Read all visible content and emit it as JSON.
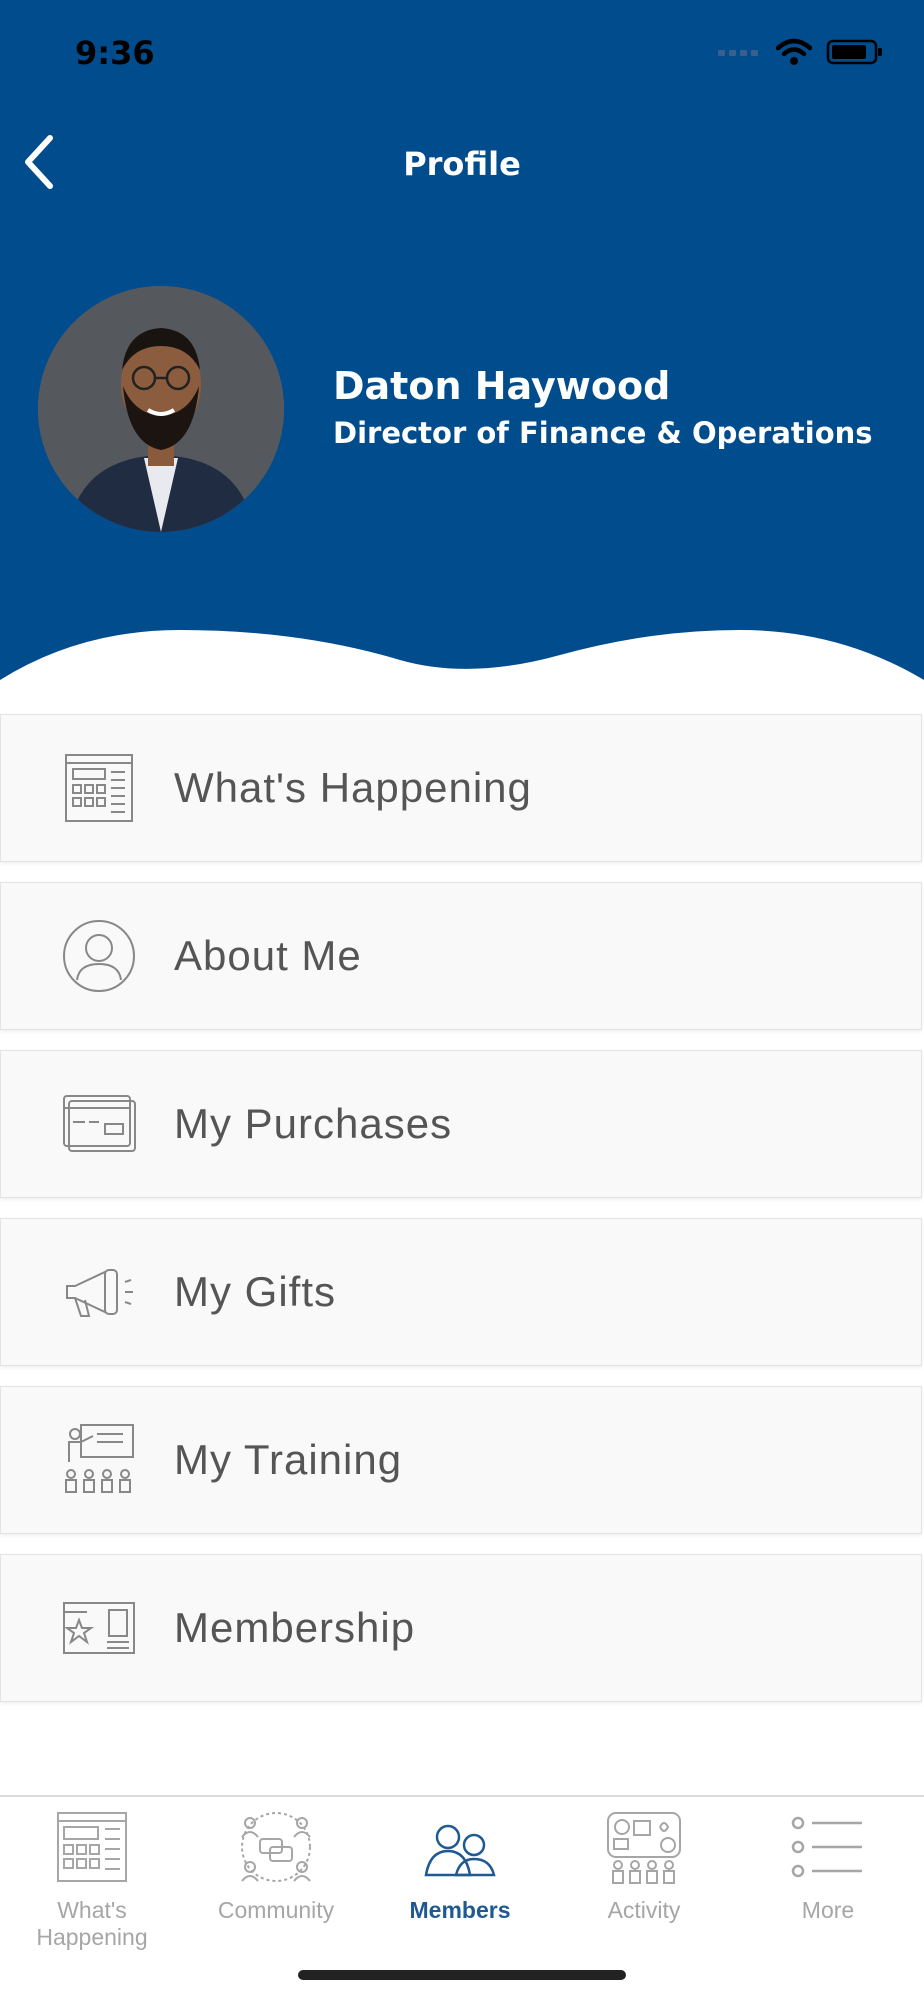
{
  "status_bar": {
    "time": "9:36"
  },
  "header": {
    "title": "Profile",
    "back_icon": "chevron-left-icon",
    "background_color": "#004c8c"
  },
  "profile": {
    "name": "Daton Haywood",
    "role": "Director of Finance & Operations"
  },
  "menu": {
    "items": [
      {
        "label": "What's Happening",
        "icon": "newspaper-icon"
      },
      {
        "label": "About Me",
        "icon": "user-circle-icon"
      },
      {
        "label": "My Purchases",
        "icon": "credit-card-icon"
      },
      {
        "label": "My Gifts",
        "icon": "megaphone-icon"
      },
      {
        "label": "My Training",
        "icon": "training-icon"
      },
      {
        "label": "Membership",
        "icon": "membership-card-icon"
      }
    ]
  },
  "tabbar": {
    "active": "Members",
    "active_color": "#1d5a94",
    "tabs": [
      {
        "label": "What's Happening",
        "icon": "newspaper-icon"
      },
      {
        "label": "Community",
        "icon": "community-icon"
      },
      {
        "label": "Members",
        "icon": "members-icon"
      },
      {
        "label": "Activity",
        "icon": "activity-icon"
      },
      {
        "label": "More",
        "icon": "list-icon"
      }
    ]
  }
}
